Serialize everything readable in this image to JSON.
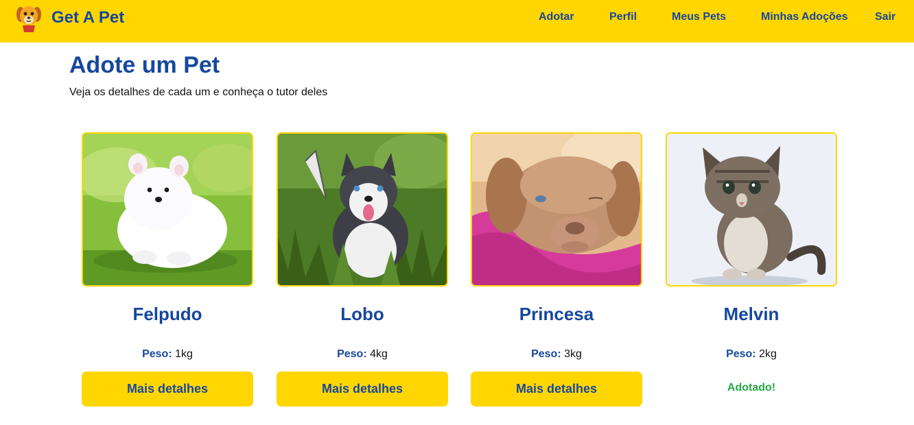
{
  "app": {
    "name": "Get A Pet",
    "logo_icon": "dog-face-icon"
  },
  "navbar": {
    "background": "#ffd600",
    "links": [
      "Adotar",
      "Perfil",
      "Meus Pets",
      "Minhas Adoções",
      "Sair"
    ]
  },
  "main": {
    "title": "Adote um Pet",
    "subtitle": "Veja os detalhes de cada um e conheça o tutor deles"
  },
  "pets": [
    {
      "name": "Felpudo",
      "weight_label": "Peso:",
      "weight": "1kg",
      "photo": "white-pomeranian-puppy-on-grass",
      "action": "Mais detalhes"
    },
    {
      "name": "Lobo",
      "weight_label": "Peso:",
      "weight": "4kg",
      "photo": "husky-puppy-in-grass",
      "action": "Mais detalhes"
    },
    {
      "name": "Princesa",
      "weight_label": "Peso:",
      "weight": "3kg",
      "photo": "brown-puppy-on-pink-blanket",
      "action": "Mais detalhes"
    },
    {
      "name": "Melvin",
      "weight_label": "Peso:",
      "weight": "2kg",
      "photo": "tabby-kitten-on-white",
      "status": "Adotado!"
    }
  ],
  "colors": {
    "accent": "#ffd600",
    "primary_text": "#16479d",
    "adopted": "#28a745"
  }
}
